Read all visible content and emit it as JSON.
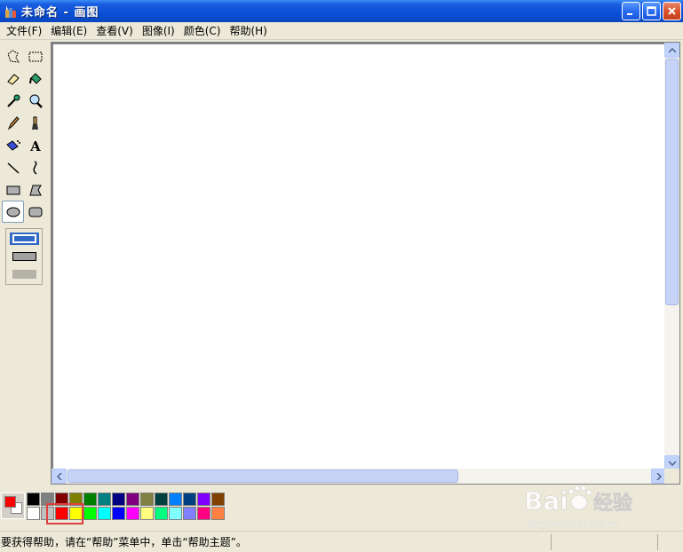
{
  "window": {
    "title": "未命名 - 画图"
  },
  "menu": {
    "items": [
      "文件(F)",
      "编辑(E)",
      "查看(V)",
      "图像(I)",
      "颜色(C)",
      "帮助(H)"
    ]
  },
  "toolbox": {
    "tools": [
      {
        "name": "free-select-icon"
      },
      {
        "name": "rect-select-icon"
      },
      {
        "name": "eraser-icon"
      },
      {
        "name": "fill-icon"
      },
      {
        "name": "color-picker-icon"
      },
      {
        "name": "magnifier-icon"
      },
      {
        "name": "pencil-icon"
      },
      {
        "name": "brush-icon"
      },
      {
        "name": "airbrush-icon"
      },
      {
        "name": "text-icon",
        "label": "A"
      },
      {
        "name": "line-icon"
      },
      {
        "name": "curve-icon"
      },
      {
        "name": "rectangle-icon"
      },
      {
        "name": "polygon-icon"
      },
      {
        "name": "ellipse-icon",
        "selected": true
      },
      {
        "name": "rounded-rect-icon"
      }
    ]
  },
  "colors": {
    "foreground": "#ff0000",
    "background": "#ffffff",
    "palette_top": [
      "#000000",
      "#808080",
      "#800000",
      "#808000",
      "#008000",
      "#008080",
      "#000080",
      "#800080",
      "#808040",
      "#004040",
      "#0080ff",
      "#004080",
      "#8000ff",
      "#804000"
    ],
    "palette_bottom": [
      "#ffffff",
      "#c0c0c0",
      "#ff0000",
      "#ffff00",
      "#00ff00",
      "#00ffff",
      "#0000ff",
      "#ff00ff",
      "#ffff80",
      "#00ff80",
      "#80ffff",
      "#8080ff",
      "#ff0080",
      "#ff8040"
    ]
  },
  "status": {
    "text": "要获得帮助，请在“帮助”菜单中，单击“帮助主题”。"
  },
  "watermark": {
    "brand": "Bai",
    "brand2": "经验",
    "url": "jingyan.baidu.com"
  }
}
